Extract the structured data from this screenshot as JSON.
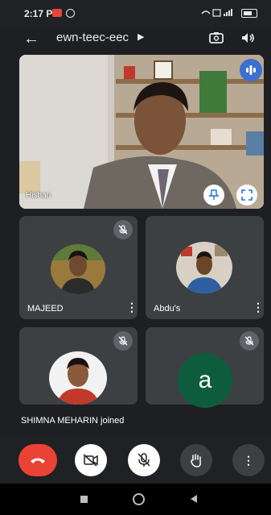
{
  "status_bar": {
    "time": "2:17 PM",
    "system_icons": "☰ ⚡ ▌▌"
  },
  "header": {
    "meeting_code": "ewn-teec-eec"
  },
  "main_video": {
    "participant_name": "Hishan"
  },
  "tiles": [
    {
      "name": "MAJEED"
    },
    {
      "name": "Abdu's"
    },
    {
      "name": ""
    },
    {
      "name": "",
      "avatar_letter": "a"
    }
  ],
  "notification": {
    "text": "SHIMNA MEHARIN joined"
  },
  "colors": {
    "end_call": "#ea4335",
    "tile_bg": "#3c4043",
    "avatar_green": "#0e5c3e",
    "audio_indicator": "#3c6fd0"
  }
}
